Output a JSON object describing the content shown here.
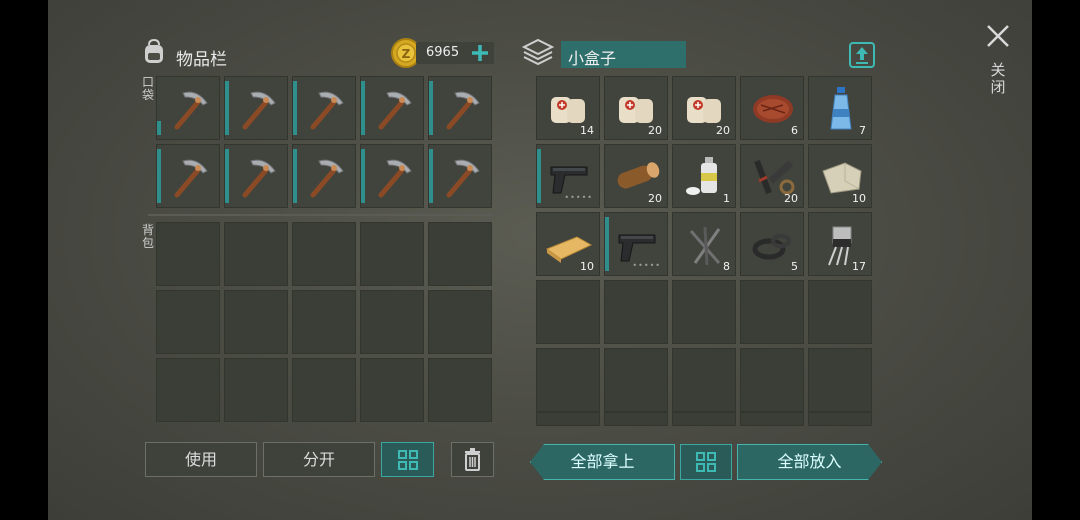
{
  "inventory": {
    "title": "物品栏",
    "gold": "6965",
    "pocket_label": "口袋",
    "backpack_label": "背包"
  },
  "container": {
    "name": "小盒子"
  },
  "close": {
    "label": "关闭"
  },
  "buttons": {
    "use": "使用",
    "split": "分开",
    "take_all": "全部拿上",
    "put_all": "全部放入"
  },
  "pocket_slots": [
    {
      "icon": "pickaxe-icon"
    },
    {
      "icon": "pickaxe-icon"
    },
    {
      "icon": "pickaxe-icon"
    },
    {
      "icon": "pickaxe-icon"
    },
    {
      "icon": "pickaxe-icon"
    },
    {
      "icon": "pickaxe-icon"
    },
    {
      "icon": "pickaxe-icon"
    },
    {
      "icon": "pickaxe-icon"
    },
    {
      "icon": "pickaxe-icon"
    },
    {
      "icon": "pickaxe-icon"
    }
  ],
  "container_slots": [
    {
      "icon": "bandage-icon",
      "count": "14"
    },
    {
      "icon": "bandage-icon",
      "count": "20"
    },
    {
      "icon": "bandage-icon",
      "count": "20"
    },
    {
      "icon": "steak-icon",
      "count": "6"
    },
    {
      "icon": "water-bottle-icon",
      "count": "7"
    },
    {
      "icon": "pistol-icon",
      "count": ""
    },
    {
      "icon": "log-icon",
      "count": "20"
    },
    {
      "icon": "spray-can-icon",
      "count": "1"
    },
    {
      "icon": "gun-parts-icon",
      "count": "20"
    },
    {
      "icon": "stone-icon",
      "count": "10"
    },
    {
      "icon": "plank-icon",
      "count": "10"
    },
    {
      "icon": "pistol-icon",
      "count": ""
    },
    {
      "icon": "nails-icon",
      "count": "8"
    },
    {
      "icon": "rubber-seals-icon",
      "count": "5"
    },
    {
      "icon": "transistor-icon",
      "count": "17"
    }
  ],
  "colors": {
    "accent": "#3aa7a1",
    "background": "#4c4d45",
    "slot": "#3b3d37"
  }
}
